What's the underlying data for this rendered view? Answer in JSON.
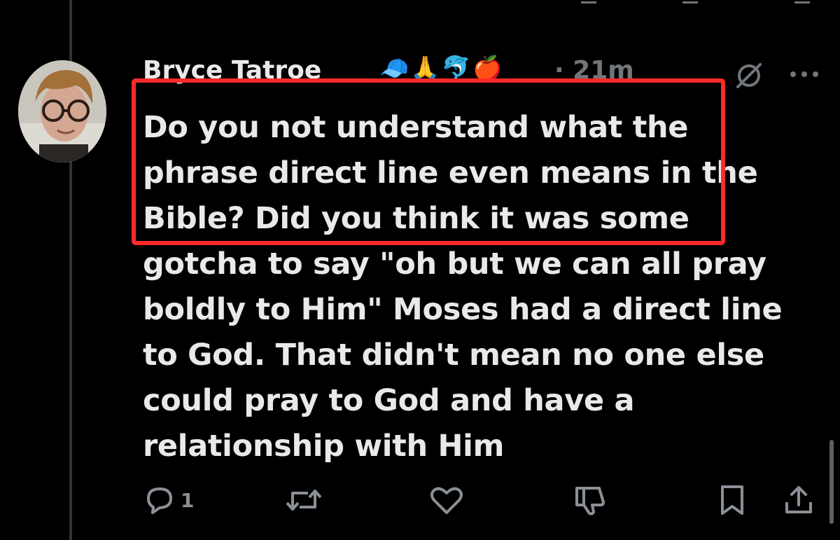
{
  "tweet": {
    "author_name": "Bryce Tatroe",
    "author_emojis": "🧢🙏🐬🍎",
    "timestamp": "· 21m",
    "text_lines": [
      "Do you not understand what the",
      "phrase direct line even means in the",
      "Bible? Did you think it was some",
      "gotcha to say \"oh but we can all pray",
      "boldly to Him\" Moses had a direct line",
      "to God. That didn't mean no one else",
      "could pray to God and have a",
      "relationship with Him"
    ]
  },
  "actions": {
    "reply_count": "1",
    "icons": [
      "reply-icon",
      "retweet-icon",
      "like-icon",
      "dislike-icon",
      "bookmark-icon",
      "share-icon"
    ]
  },
  "annotation": {
    "highlight_color": "#ff2a2a"
  },
  "colors": {
    "background": "#000000",
    "text": "#e7e9ea",
    "muted": "#71767b"
  }
}
